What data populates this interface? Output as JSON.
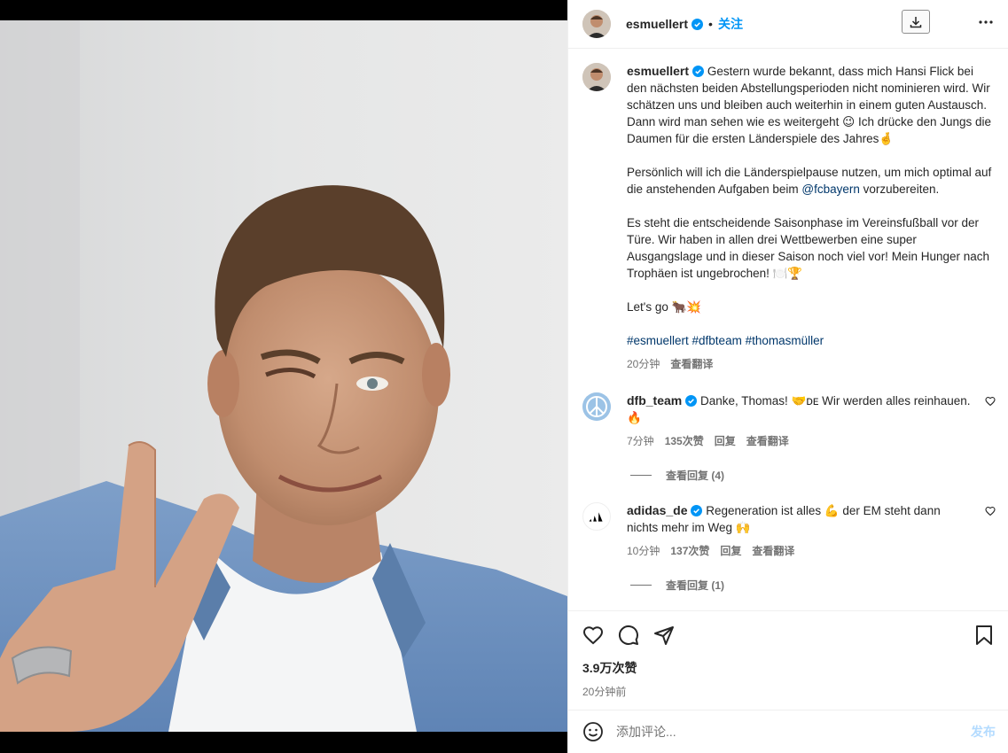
{
  "header": {
    "username": "esmuellert",
    "follow_label": "关注",
    "dot": "•"
  },
  "caption": {
    "username": "esmuellert",
    "p1_a": "Gestern wurde bekannt, dass mich Hansi Flick bei den nächsten beiden Abstellungsperioden nicht nominieren wird. Wir schätzen uns und bleiben auch weiterhin in einem guten Austausch. Dann wird man sehen wie es weitergeht ",
    "p1_emoji1": "😉",
    "p1_b": " Ich drücke den Jungs die Daumen für die ersten Länderspiele des Jahres",
    "p1_emoji2": "🤞",
    "p2_a": "Persönlich will ich die Länderspielpause nutzen, um mich optimal auf die anstehenden Aufgaben beim ",
    "p2_mention": "@fcbayern",
    "p2_b": " vorzubereiten.",
    "p3": "Es steht die entscheidende Saisonphase im Vereinsfußball vor der Türe. Wir haben in allen drei Wettbewerben eine super Ausgangslage und in dieser Saison noch viel vor! Mein Hunger nach Trophäen ist ungebrochen! ",
    "p3_emoji": "🍽️🏆",
    "p4": "Let's go ",
    "p4_emoji": "🐂💥",
    "hashtags": "#esmuellert #dfbteam #thomasmüller",
    "time": "20分钟",
    "translate": "查看翻译"
  },
  "comments": [
    {
      "username": "dfb_team",
      "text_a": "Danke, Thomas! ",
      "emoji_a": "🤝",
      "text_b": "ᴅᴇ Wir werden alles reinhauen. ",
      "emoji_b": "🔥",
      "time": "7分钟",
      "likes": "135次赞",
      "reply": "回复",
      "translate": "查看翻译",
      "replies": "查看回复 (4)"
    },
    {
      "username": "adidas_de",
      "text_a": "Regeneration ist alles ",
      "emoji_a": "💪",
      "text_b": " der EM steht dann nichts mehr im Weg ",
      "emoji_b": "🙌",
      "time": "10分钟",
      "likes": "137次赞",
      "reply": "回复",
      "translate": "查看翻译",
      "replies": "查看回复 (1)"
    }
  ],
  "footer": {
    "likes": "3.9万次赞",
    "ago": "20分钟前",
    "comment_placeholder": "添加评论...",
    "post_label": "发布"
  },
  "colors": {
    "accent": "#0095f6",
    "link": "#00376b",
    "secondary_text": "#737373",
    "verified": "#0095f6"
  },
  "icons": [
    "verified-icon",
    "download-icon",
    "more-icon",
    "heart-icon",
    "comment-icon",
    "share-icon",
    "bookmark-icon",
    "emoji-icon"
  ]
}
